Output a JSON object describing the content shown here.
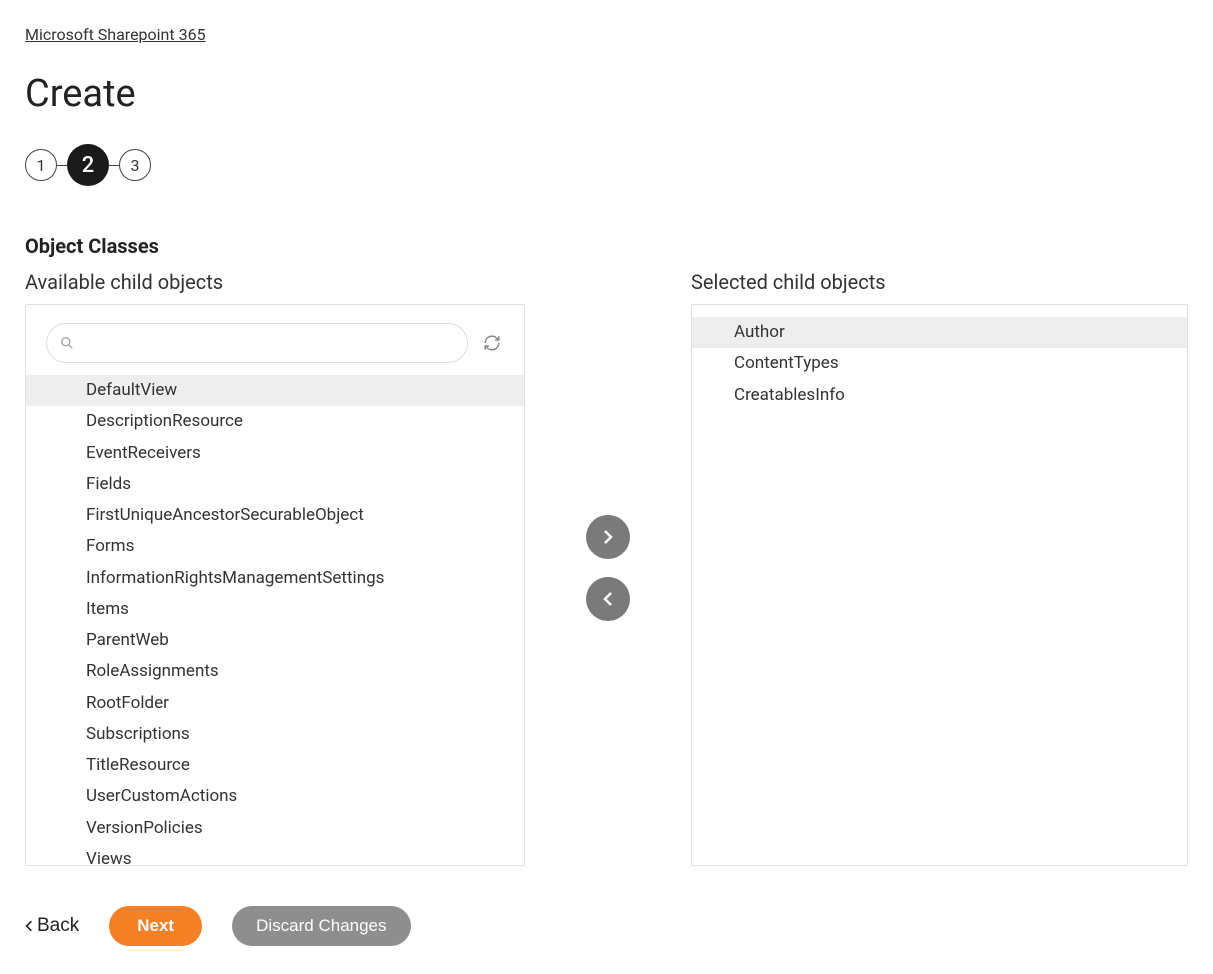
{
  "breadcrumb": {
    "label": "Microsoft Sharepoint 365"
  },
  "page_title": "Create",
  "stepper": {
    "steps": [
      "1",
      "2",
      "3"
    ],
    "active_index": 1
  },
  "section_heading": "Object Classes",
  "available": {
    "label": "Available child objects",
    "search_placeholder": "",
    "selected_index": 0,
    "items": [
      "DefaultView",
      "DescriptionResource",
      "EventReceivers",
      "Fields",
      "FirstUniqueAncestorSecurableObject",
      "Forms",
      "InformationRightsManagementSettings",
      "Items",
      "ParentWeb",
      "RoleAssignments",
      "RootFolder",
      "Subscriptions",
      "TitleResource",
      "UserCustomActions",
      "VersionPolicies",
      "Views"
    ]
  },
  "selected": {
    "label": "Selected child objects",
    "selected_index": 0,
    "items": [
      "Author",
      "ContentTypes",
      "CreatablesInfo"
    ]
  },
  "footer": {
    "back": "Back",
    "next": "Next",
    "discard": "Discard Changes"
  }
}
